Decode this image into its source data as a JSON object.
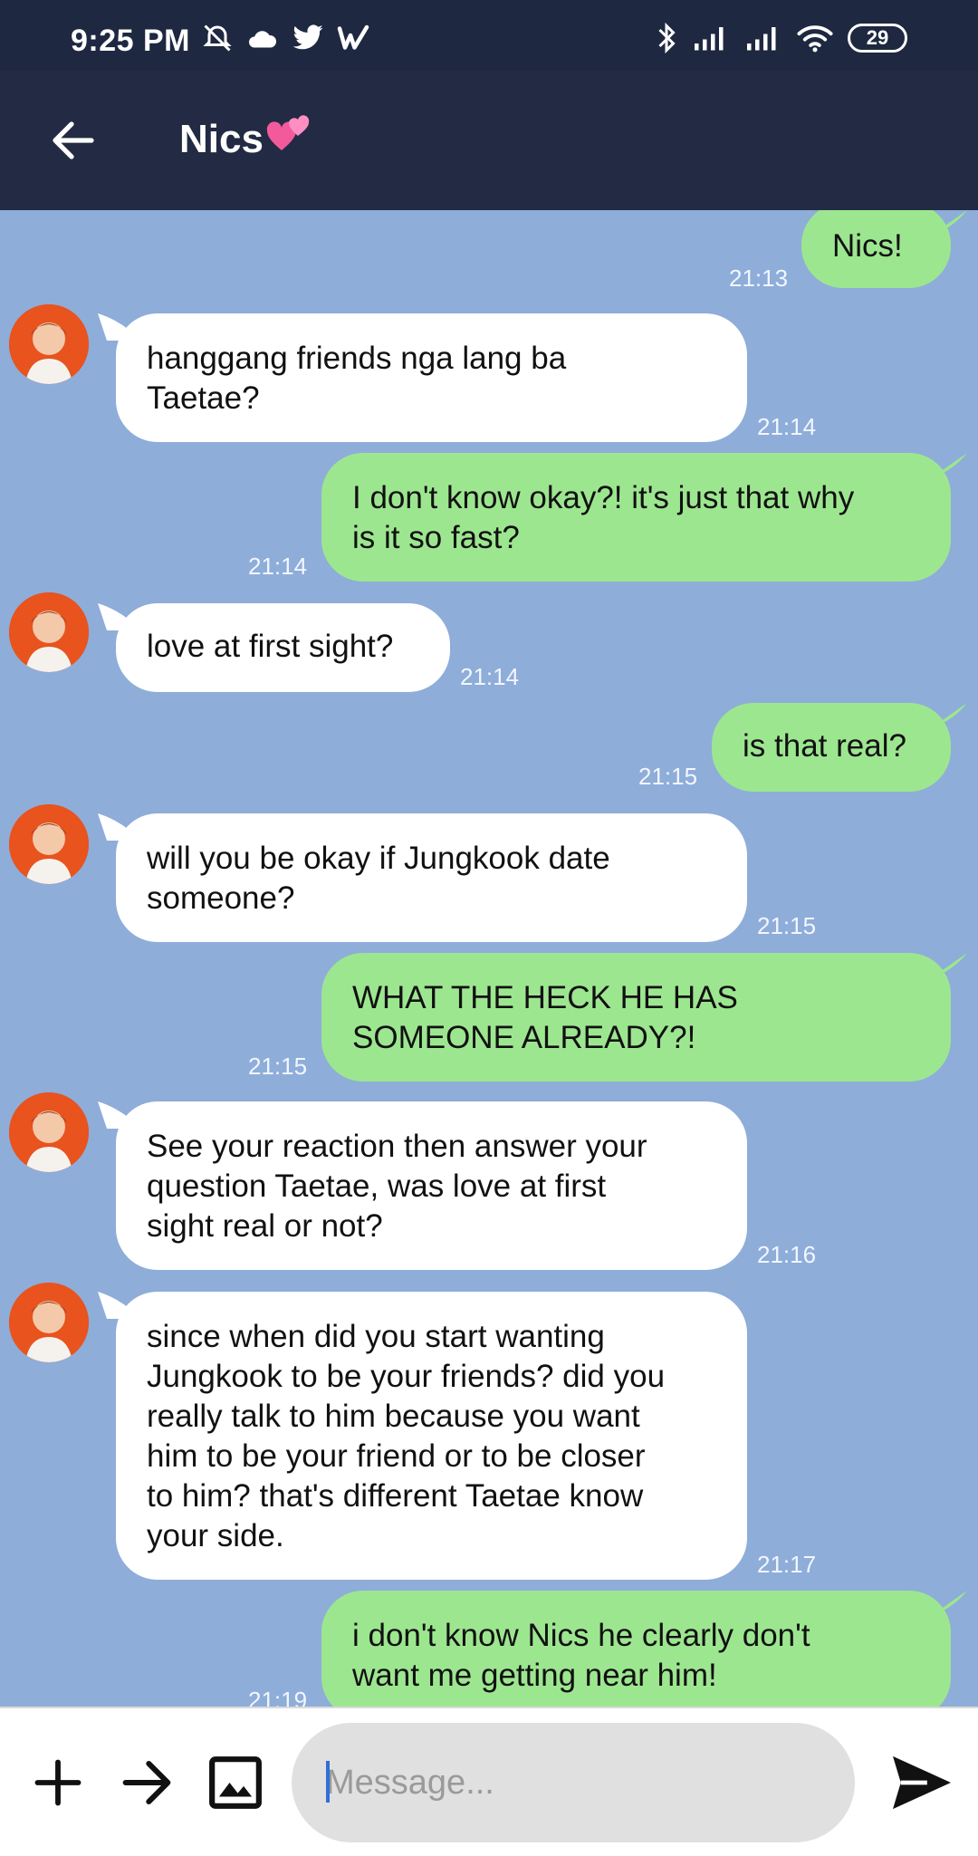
{
  "status_bar": {
    "time": "9:25 PM",
    "battery": "29",
    "icons": [
      "alarm-off-icon",
      "cloud-icon",
      "twitter-icon",
      "wattpad-icon",
      "bluetooth-icon",
      "signal-icon",
      "signal-icon",
      "wifi-icon",
      "battery-icon"
    ]
  },
  "header": {
    "title": "Nics",
    "title_emoji": "💞",
    "back_icon": "arrow-left-icon"
  },
  "messages": [
    {
      "dir": "out",
      "text": "Nics!",
      "time": "21:13"
    },
    {
      "dir": "in",
      "text": "hanggang friends nga lang ba\nTaetae?",
      "time": "21:14"
    },
    {
      "dir": "out",
      "text": "I don't know okay?! it's just that why\nis it so fast?",
      "time": "21:14"
    },
    {
      "dir": "in",
      "text": "love at first sight?",
      "time": "21:14"
    },
    {
      "dir": "out",
      "text": "is that real?",
      "time": "21:15"
    },
    {
      "dir": "in",
      "text": "will you be okay if Jungkook date\nsomeone?",
      "time": "21:15"
    },
    {
      "dir": "out",
      "text": "WHAT THE HECK HE HAS\nSOMEONE ALREADY?!",
      "time": "21:15"
    },
    {
      "dir": "in",
      "text": "See your reaction then answer your\nquestion Taetae, was love at first\nsight real or not?",
      "time": "21:16"
    },
    {
      "dir": "in",
      "text": "since when did you start wanting\nJungkook to be your friends? did you\nreally talk to him because you want\nhim to be your friend or to be closer\nto him? that's different Taetae know\nyour side.",
      "time": "21:17"
    },
    {
      "dir": "out",
      "text": "i don't know Nics he clearly don't\nwant me getting near him!",
      "time": "21:19"
    }
  ],
  "input_bar": {
    "placeholder": "Message...",
    "value": "",
    "icons": [
      "plus-icon",
      "forward-arrow-icon",
      "image-icon",
      "send-icon"
    ]
  },
  "colors": {
    "chat_background": "#8eadd9",
    "header_background": "#222b43",
    "incoming_bubble": "#ffffff",
    "outgoing_bubble": "#9de690"
  }
}
